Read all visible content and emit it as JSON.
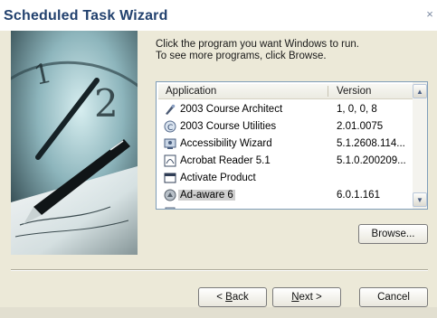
{
  "window": {
    "title": "Scheduled Task Wizard"
  },
  "instructions": {
    "line1": "Click the program you want Windows to run.",
    "line2": "To see more programs, click Browse."
  },
  "list": {
    "columns": {
      "application": "Application",
      "version": "Version"
    },
    "rows": [
      {
        "name": "2003 Course Architect",
        "version": "1, 0, 0, 8",
        "icon": "course-architect-icon"
      },
      {
        "name": "2003 Course Utilities",
        "version": "2.01.0075",
        "icon": "course-utilities-icon"
      },
      {
        "name": "Accessibility Wizard",
        "version": "5.1.2608.114...",
        "icon": "accessibility-wizard-icon"
      },
      {
        "name": "Acrobat Reader 5.1",
        "version": "5.1.0.200209...",
        "icon": "acrobat-reader-icon"
      },
      {
        "name": "Activate Product",
        "version": "",
        "icon": "window-icon"
      },
      {
        "name": "Ad-aware 6",
        "version": "6.0.1.161",
        "icon": "adaware-icon",
        "selected": true
      }
    ]
  },
  "buttons": {
    "browse": "Browse...",
    "back_pre": "< ",
    "back_key": "B",
    "back_post": "ack",
    "next_pre": "",
    "next_key": "N",
    "next_post": "ext >",
    "cancel": "Cancel"
  },
  "colors": {
    "title": "#22416e",
    "selection": "#cfcfcf"
  }
}
